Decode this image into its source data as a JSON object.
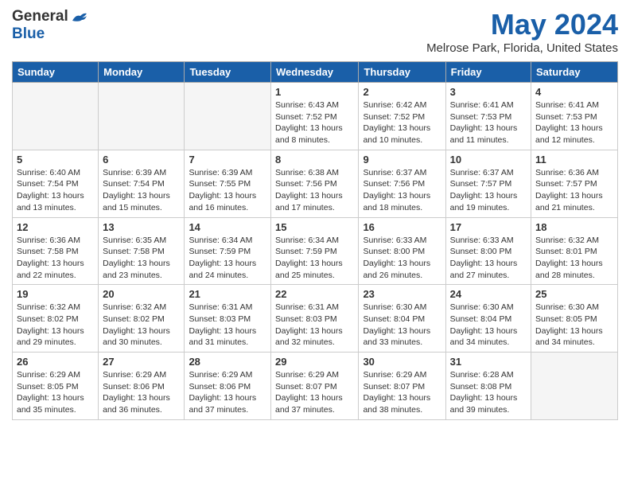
{
  "header": {
    "logo_general": "General",
    "logo_blue": "Blue",
    "title": "May 2024",
    "subtitle": "Melrose Park, Florida, United States"
  },
  "weekdays": [
    "Sunday",
    "Monday",
    "Tuesday",
    "Wednesday",
    "Thursday",
    "Friday",
    "Saturday"
  ],
  "weeks": [
    [
      {
        "day": "",
        "empty": true
      },
      {
        "day": "",
        "empty": true
      },
      {
        "day": "",
        "empty": true
      },
      {
        "day": "1",
        "info": "Sunrise: 6:43 AM\nSunset: 7:52 PM\nDaylight: 13 hours\nand 8 minutes."
      },
      {
        "day": "2",
        "info": "Sunrise: 6:42 AM\nSunset: 7:52 PM\nDaylight: 13 hours\nand 10 minutes."
      },
      {
        "day": "3",
        "info": "Sunrise: 6:41 AM\nSunset: 7:53 PM\nDaylight: 13 hours\nand 11 minutes."
      },
      {
        "day": "4",
        "info": "Sunrise: 6:41 AM\nSunset: 7:53 PM\nDaylight: 13 hours\nand 12 minutes."
      }
    ],
    [
      {
        "day": "5",
        "info": "Sunrise: 6:40 AM\nSunset: 7:54 PM\nDaylight: 13 hours\nand 13 minutes."
      },
      {
        "day": "6",
        "info": "Sunrise: 6:39 AM\nSunset: 7:54 PM\nDaylight: 13 hours\nand 15 minutes."
      },
      {
        "day": "7",
        "info": "Sunrise: 6:39 AM\nSunset: 7:55 PM\nDaylight: 13 hours\nand 16 minutes."
      },
      {
        "day": "8",
        "info": "Sunrise: 6:38 AM\nSunset: 7:56 PM\nDaylight: 13 hours\nand 17 minutes."
      },
      {
        "day": "9",
        "info": "Sunrise: 6:37 AM\nSunset: 7:56 PM\nDaylight: 13 hours\nand 18 minutes."
      },
      {
        "day": "10",
        "info": "Sunrise: 6:37 AM\nSunset: 7:57 PM\nDaylight: 13 hours\nand 19 minutes."
      },
      {
        "day": "11",
        "info": "Sunrise: 6:36 AM\nSunset: 7:57 PM\nDaylight: 13 hours\nand 21 minutes."
      }
    ],
    [
      {
        "day": "12",
        "info": "Sunrise: 6:36 AM\nSunset: 7:58 PM\nDaylight: 13 hours\nand 22 minutes."
      },
      {
        "day": "13",
        "info": "Sunrise: 6:35 AM\nSunset: 7:58 PM\nDaylight: 13 hours\nand 23 minutes."
      },
      {
        "day": "14",
        "info": "Sunrise: 6:34 AM\nSunset: 7:59 PM\nDaylight: 13 hours\nand 24 minutes."
      },
      {
        "day": "15",
        "info": "Sunrise: 6:34 AM\nSunset: 7:59 PM\nDaylight: 13 hours\nand 25 minutes."
      },
      {
        "day": "16",
        "info": "Sunrise: 6:33 AM\nSunset: 8:00 PM\nDaylight: 13 hours\nand 26 minutes."
      },
      {
        "day": "17",
        "info": "Sunrise: 6:33 AM\nSunset: 8:00 PM\nDaylight: 13 hours\nand 27 minutes."
      },
      {
        "day": "18",
        "info": "Sunrise: 6:32 AM\nSunset: 8:01 PM\nDaylight: 13 hours\nand 28 minutes."
      }
    ],
    [
      {
        "day": "19",
        "info": "Sunrise: 6:32 AM\nSunset: 8:02 PM\nDaylight: 13 hours\nand 29 minutes."
      },
      {
        "day": "20",
        "info": "Sunrise: 6:32 AM\nSunset: 8:02 PM\nDaylight: 13 hours\nand 30 minutes."
      },
      {
        "day": "21",
        "info": "Sunrise: 6:31 AM\nSunset: 8:03 PM\nDaylight: 13 hours\nand 31 minutes."
      },
      {
        "day": "22",
        "info": "Sunrise: 6:31 AM\nSunset: 8:03 PM\nDaylight: 13 hours\nand 32 minutes."
      },
      {
        "day": "23",
        "info": "Sunrise: 6:30 AM\nSunset: 8:04 PM\nDaylight: 13 hours\nand 33 minutes."
      },
      {
        "day": "24",
        "info": "Sunrise: 6:30 AM\nSunset: 8:04 PM\nDaylight: 13 hours\nand 34 minutes."
      },
      {
        "day": "25",
        "info": "Sunrise: 6:30 AM\nSunset: 8:05 PM\nDaylight: 13 hours\nand 34 minutes."
      }
    ],
    [
      {
        "day": "26",
        "info": "Sunrise: 6:29 AM\nSunset: 8:05 PM\nDaylight: 13 hours\nand 35 minutes."
      },
      {
        "day": "27",
        "info": "Sunrise: 6:29 AM\nSunset: 8:06 PM\nDaylight: 13 hours\nand 36 minutes."
      },
      {
        "day": "28",
        "info": "Sunrise: 6:29 AM\nSunset: 8:06 PM\nDaylight: 13 hours\nand 37 minutes."
      },
      {
        "day": "29",
        "info": "Sunrise: 6:29 AM\nSunset: 8:07 PM\nDaylight: 13 hours\nand 37 minutes."
      },
      {
        "day": "30",
        "info": "Sunrise: 6:29 AM\nSunset: 8:07 PM\nDaylight: 13 hours\nand 38 minutes."
      },
      {
        "day": "31",
        "info": "Sunrise: 6:28 AM\nSunset: 8:08 PM\nDaylight: 13 hours\nand 39 minutes."
      },
      {
        "day": "",
        "empty": true
      }
    ]
  ]
}
